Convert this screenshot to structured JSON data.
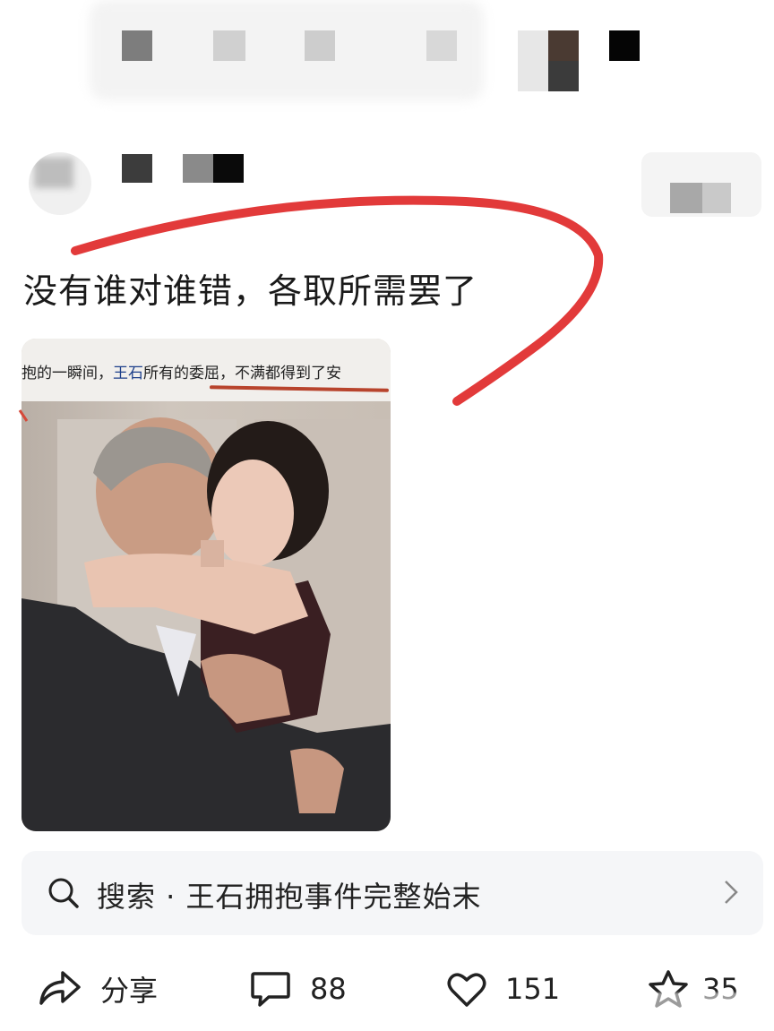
{
  "post": {
    "text": "没有谁对谁错，各取所需罢了",
    "image_caption_prefix": "抱的一瞬间，",
    "image_caption_highlight": "王石",
    "image_caption_suffix": "所有的委屈，不满都得到了安"
  },
  "search": {
    "label": "搜索 · 王石拥抱事件完整始末"
  },
  "actions": {
    "share_label": "分享",
    "comment_count": "88",
    "like_count": "151",
    "favorite_count": "35"
  },
  "colors": {
    "annotation_red": "#e23a3a",
    "background": "#ffffff",
    "search_bg": "#f5f6f8"
  },
  "icons": [
    "search-icon",
    "chevron-right-icon",
    "share-icon",
    "comment-icon",
    "heart-icon",
    "star-icon"
  ]
}
